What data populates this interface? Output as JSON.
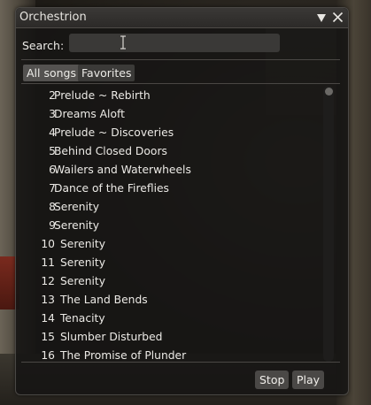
{
  "window": {
    "title": "Orchestrion"
  },
  "search": {
    "label": "Search:",
    "value": "",
    "placeholder": ""
  },
  "tabs": [
    {
      "label": "All songs",
      "active": true
    },
    {
      "label": "Favorites",
      "active": false
    }
  ],
  "songs": [
    {
      "number": "2",
      "name": "Prelude ~ Rebirth"
    },
    {
      "number": "3",
      "name": "Dreams Aloft"
    },
    {
      "number": "4",
      "name": "Prelude ~ Discoveries"
    },
    {
      "number": "5",
      "name": "Behind Closed Doors"
    },
    {
      "number": "6",
      "name": "Wailers and Waterwheels"
    },
    {
      "number": "7",
      "name": "Dance of the Fireflies"
    },
    {
      "number": "8",
      "name": "Serenity"
    },
    {
      "number": "9",
      "name": "Serenity"
    },
    {
      "number": "10",
      "name": "Serenity"
    },
    {
      "number": "11",
      "name": "Serenity"
    },
    {
      "number": "12",
      "name": "Serenity"
    },
    {
      "number": "13",
      "name": "The Land Bends"
    },
    {
      "number": "14",
      "name": "Tenacity"
    },
    {
      "number": "15",
      "name": "Slumber Disturbed"
    },
    {
      "number": "16",
      "name": "The Promise of Plunder"
    }
  ],
  "buttons": {
    "stop": "Stop",
    "play": "Play"
  },
  "icons": {
    "collapse": "triangle-down-icon",
    "close": "close-icon"
  }
}
